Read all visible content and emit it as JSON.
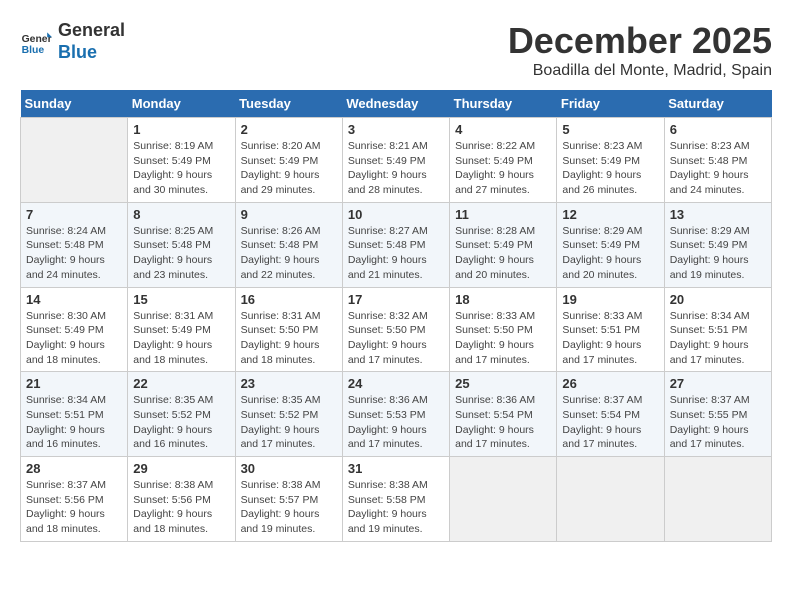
{
  "header": {
    "logo_line1": "General",
    "logo_line2": "Blue",
    "title": "December 2025",
    "subtitle": "Boadilla del Monte, Madrid, Spain"
  },
  "weekdays": [
    "Sunday",
    "Monday",
    "Tuesday",
    "Wednesday",
    "Thursday",
    "Friday",
    "Saturday"
  ],
  "weeks": [
    [
      {
        "day": "",
        "sunrise": "",
        "sunset": "",
        "daylight": ""
      },
      {
        "day": "1",
        "sunrise": "Sunrise: 8:19 AM",
        "sunset": "Sunset: 5:49 PM",
        "daylight": "Daylight: 9 hours and 30 minutes."
      },
      {
        "day": "2",
        "sunrise": "Sunrise: 8:20 AM",
        "sunset": "Sunset: 5:49 PM",
        "daylight": "Daylight: 9 hours and 29 minutes."
      },
      {
        "day": "3",
        "sunrise": "Sunrise: 8:21 AM",
        "sunset": "Sunset: 5:49 PM",
        "daylight": "Daylight: 9 hours and 28 minutes."
      },
      {
        "day": "4",
        "sunrise": "Sunrise: 8:22 AM",
        "sunset": "Sunset: 5:49 PM",
        "daylight": "Daylight: 9 hours and 27 minutes."
      },
      {
        "day": "5",
        "sunrise": "Sunrise: 8:23 AM",
        "sunset": "Sunset: 5:49 PM",
        "daylight": "Daylight: 9 hours and 26 minutes."
      },
      {
        "day": "6",
        "sunrise": "Sunrise: 8:23 AM",
        "sunset": "Sunset: 5:48 PM",
        "daylight": "Daylight: 9 hours and 24 minutes."
      }
    ],
    [
      {
        "day": "7",
        "sunrise": "Sunrise: 8:24 AM",
        "sunset": "Sunset: 5:48 PM",
        "daylight": "Daylight: 9 hours and 24 minutes."
      },
      {
        "day": "8",
        "sunrise": "Sunrise: 8:25 AM",
        "sunset": "Sunset: 5:48 PM",
        "daylight": "Daylight: 9 hours and 23 minutes."
      },
      {
        "day": "9",
        "sunrise": "Sunrise: 8:26 AM",
        "sunset": "Sunset: 5:48 PM",
        "daylight": "Daylight: 9 hours and 22 minutes."
      },
      {
        "day": "10",
        "sunrise": "Sunrise: 8:27 AM",
        "sunset": "Sunset: 5:48 PM",
        "daylight": "Daylight: 9 hours and 21 minutes."
      },
      {
        "day": "11",
        "sunrise": "Sunrise: 8:28 AM",
        "sunset": "Sunset: 5:49 PM",
        "daylight": "Daylight: 9 hours and 20 minutes."
      },
      {
        "day": "12",
        "sunrise": "Sunrise: 8:29 AM",
        "sunset": "Sunset: 5:49 PM",
        "daylight": "Daylight: 9 hours and 20 minutes."
      },
      {
        "day": "13",
        "sunrise": "Sunrise: 8:29 AM",
        "sunset": "Sunset: 5:49 PM",
        "daylight": "Daylight: 9 hours and 19 minutes."
      }
    ],
    [
      {
        "day": "14",
        "sunrise": "Sunrise: 8:30 AM",
        "sunset": "Sunset: 5:49 PM",
        "daylight": "Daylight: 9 hours and 18 minutes."
      },
      {
        "day": "15",
        "sunrise": "Sunrise: 8:31 AM",
        "sunset": "Sunset: 5:49 PM",
        "daylight": "Daylight: 9 hours and 18 minutes."
      },
      {
        "day": "16",
        "sunrise": "Sunrise: 8:31 AM",
        "sunset": "Sunset: 5:50 PM",
        "daylight": "Daylight: 9 hours and 18 minutes."
      },
      {
        "day": "17",
        "sunrise": "Sunrise: 8:32 AM",
        "sunset": "Sunset: 5:50 PM",
        "daylight": "Daylight: 9 hours and 17 minutes."
      },
      {
        "day": "18",
        "sunrise": "Sunrise: 8:33 AM",
        "sunset": "Sunset: 5:50 PM",
        "daylight": "Daylight: 9 hours and 17 minutes."
      },
      {
        "day": "19",
        "sunrise": "Sunrise: 8:33 AM",
        "sunset": "Sunset: 5:51 PM",
        "daylight": "Daylight: 9 hours and 17 minutes."
      },
      {
        "day": "20",
        "sunrise": "Sunrise: 8:34 AM",
        "sunset": "Sunset: 5:51 PM",
        "daylight": "Daylight: 9 hours and 17 minutes."
      }
    ],
    [
      {
        "day": "21",
        "sunrise": "Sunrise: 8:34 AM",
        "sunset": "Sunset: 5:51 PM",
        "daylight": "Daylight: 9 hours and 16 minutes."
      },
      {
        "day": "22",
        "sunrise": "Sunrise: 8:35 AM",
        "sunset": "Sunset: 5:52 PM",
        "daylight": "Daylight: 9 hours and 16 minutes."
      },
      {
        "day": "23",
        "sunrise": "Sunrise: 8:35 AM",
        "sunset": "Sunset: 5:52 PM",
        "daylight": "Daylight: 9 hours and 17 minutes."
      },
      {
        "day": "24",
        "sunrise": "Sunrise: 8:36 AM",
        "sunset": "Sunset: 5:53 PM",
        "daylight": "Daylight: 9 hours and 17 minutes."
      },
      {
        "day": "25",
        "sunrise": "Sunrise: 8:36 AM",
        "sunset": "Sunset: 5:54 PM",
        "daylight": "Daylight: 9 hours and 17 minutes."
      },
      {
        "day": "26",
        "sunrise": "Sunrise: 8:37 AM",
        "sunset": "Sunset: 5:54 PM",
        "daylight": "Daylight: 9 hours and 17 minutes."
      },
      {
        "day": "27",
        "sunrise": "Sunrise: 8:37 AM",
        "sunset": "Sunset: 5:55 PM",
        "daylight": "Daylight: 9 hours and 17 minutes."
      }
    ],
    [
      {
        "day": "28",
        "sunrise": "Sunrise: 8:37 AM",
        "sunset": "Sunset: 5:56 PM",
        "daylight": "Daylight: 9 hours and 18 minutes."
      },
      {
        "day": "29",
        "sunrise": "Sunrise: 8:38 AM",
        "sunset": "Sunset: 5:56 PM",
        "daylight": "Daylight: 9 hours and 18 minutes."
      },
      {
        "day": "30",
        "sunrise": "Sunrise: 8:38 AM",
        "sunset": "Sunset: 5:57 PM",
        "daylight": "Daylight: 9 hours and 19 minutes."
      },
      {
        "day": "31",
        "sunrise": "Sunrise: 8:38 AM",
        "sunset": "Sunset: 5:58 PM",
        "daylight": "Daylight: 9 hours and 19 minutes."
      },
      {
        "day": "",
        "sunrise": "",
        "sunset": "",
        "daylight": ""
      },
      {
        "day": "",
        "sunrise": "",
        "sunset": "",
        "daylight": ""
      },
      {
        "day": "",
        "sunrise": "",
        "sunset": "",
        "daylight": ""
      }
    ]
  ]
}
